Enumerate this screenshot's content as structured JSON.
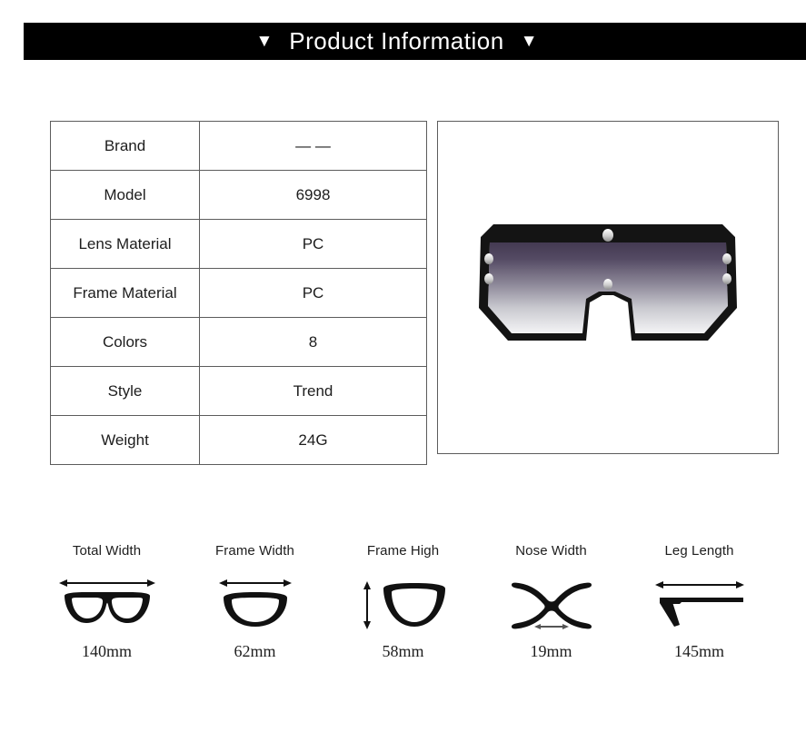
{
  "header": {
    "title": "Product Information",
    "left_marker": "▼",
    "right_marker": "▼",
    "background": "#000000",
    "text_color": "#ffffff"
  },
  "spec_table": {
    "rows": [
      {
        "key": "Brand",
        "value": "— —"
      },
      {
        "key": "Model",
        "value": "6998"
      },
      {
        "key": "Lens Material",
        "value": "PC"
      },
      {
        "key": "Frame Material",
        "value": "PC"
      },
      {
        "key": "Colors",
        "value": "8"
      },
      {
        "key": "Style",
        "value": "Trend"
      },
      {
        "key": "Weight",
        "value": "24G"
      }
    ]
  },
  "product_image": {
    "alt": "black oversized shield sunglasses with gradient lens",
    "frame_color": "#141414",
    "lens_top_color": "#4a3f56",
    "lens_bottom_color": "#f2f2f4",
    "rivet_color": "#d8d8d8"
  },
  "measurements": [
    {
      "label": "Total Width",
      "value": "140mm",
      "icon": "full-frame-width-icon"
    },
    {
      "label": "Frame Width",
      "value": "62mm",
      "icon": "lens-width-icon"
    },
    {
      "label": "Frame High",
      "value": "58mm",
      "icon": "lens-height-icon"
    },
    {
      "label": "Nose Width",
      "value": "19mm",
      "icon": "nose-bridge-icon"
    },
    {
      "label": "Leg Length",
      "value": "145mm",
      "icon": "temple-arm-icon"
    }
  ]
}
